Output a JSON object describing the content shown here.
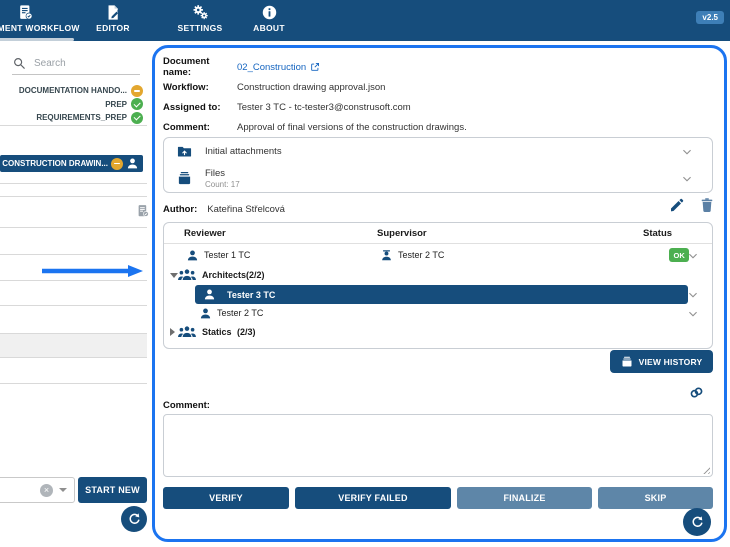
{
  "toolbar": {
    "tabs": [
      {
        "label": "DOCUMENT WORKFLOW",
        "active": true
      },
      {
        "label": "EDITOR",
        "active": false
      },
      {
        "label": "SETTINGS",
        "active": false
      },
      {
        "label": "ABOUT",
        "active": false
      }
    ],
    "version": "v2.5"
  },
  "sidebar": {
    "search_placeholder": "Search",
    "items": [
      {
        "label": "DOCUMENTATION HANDO...",
        "status": "in-progress"
      },
      {
        "label": "PREP",
        "status": "done"
      },
      {
        "label": "REQUIREMENTS_PREP",
        "status": "done"
      }
    ],
    "selected": {
      "label": "CONSTRUCTION DRAWIN...",
      "status": "in-progress"
    },
    "start_new": "START NEW"
  },
  "doc": {
    "fields": [
      {
        "label": "Document name:",
        "value": "02_Construction"
      },
      {
        "label": "Workflow:",
        "value": "Construction drawing approval.json"
      },
      {
        "label": "Assigned to:",
        "value": "Tester 3 TC - tc-tester3@construsoft.com"
      },
      {
        "label": "Comment:",
        "value": "Approval of final versions of the construction drawings."
      }
    ]
  },
  "attachments": {
    "initial": "Initial attachments",
    "files": "Files",
    "count": "Count: 17"
  },
  "author": {
    "label": "Author:",
    "name": "Kateřina Střelcová"
  },
  "review": {
    "headers": {
      "reviewer": "Reviewer",
      "supervisor": "Supervisor",
      "status": "Status"
    },
    "pair": {
      "reviewer": "Tester 1 TC",
      "supervisor": "Tester 2 TC",
      "status": "OK"
    },
    "groups": [
      {
        "name": "Architects",
        "count": "(2/2)",
        "expanded": true
      },
      {
        "name": "Statics",
        "count": "(2/3)",
        "expanded": false
      }
    ],
    "members": [
      {
        "name": "Tester 3 TC",
        "selected": true
      },
      {
        "name": "Tester 2 TC",
        "selected": false
      }
    ]
  },
  "buttons": {
    "view_history": "VIEW HISTORY",
    "verify": "VERIFY",
    "verify_failed": "VERIFY FAILED",
    "finalize": "FINALIZE",
    "skip": "SKIP"
  },
  "comment": {
    "label": "Comment:",
    "value": ""
  },
  "icons": {
    "toolbar": [
      "document-check-icon",
      "document-edit-icon",
      "gears-icon",
      "info-circle-icon"
    ],
    "status_done": "check-circle",
    "status_in_progress": "minus-circle",
    "row": [
      "person-icon",
      "supervisor-icon",
      "group-icon",
      "chevron-down-icon"
    ],
    "misc": [
      "search-icon",
      "external-link-icon",
      "pencil-icon",
      "trash-icon",
      "chain-link-icon",
      "refresh-icon",
      "folder-upload-icon",
      "files-drawer-icon",
      "arrow-right"
    ]
  },
  "colors": {
    "navy": "#164d7c",
    "slate_button": "#5e86a8",
    "panel_border_blue": "#1b74f0",
    "link_blue": "#1565c0",
    "status_green": "#4caf50",
    "status_orange": "#e3a72f",
    "badge_blue": "#3e7fb7"
  }
}
